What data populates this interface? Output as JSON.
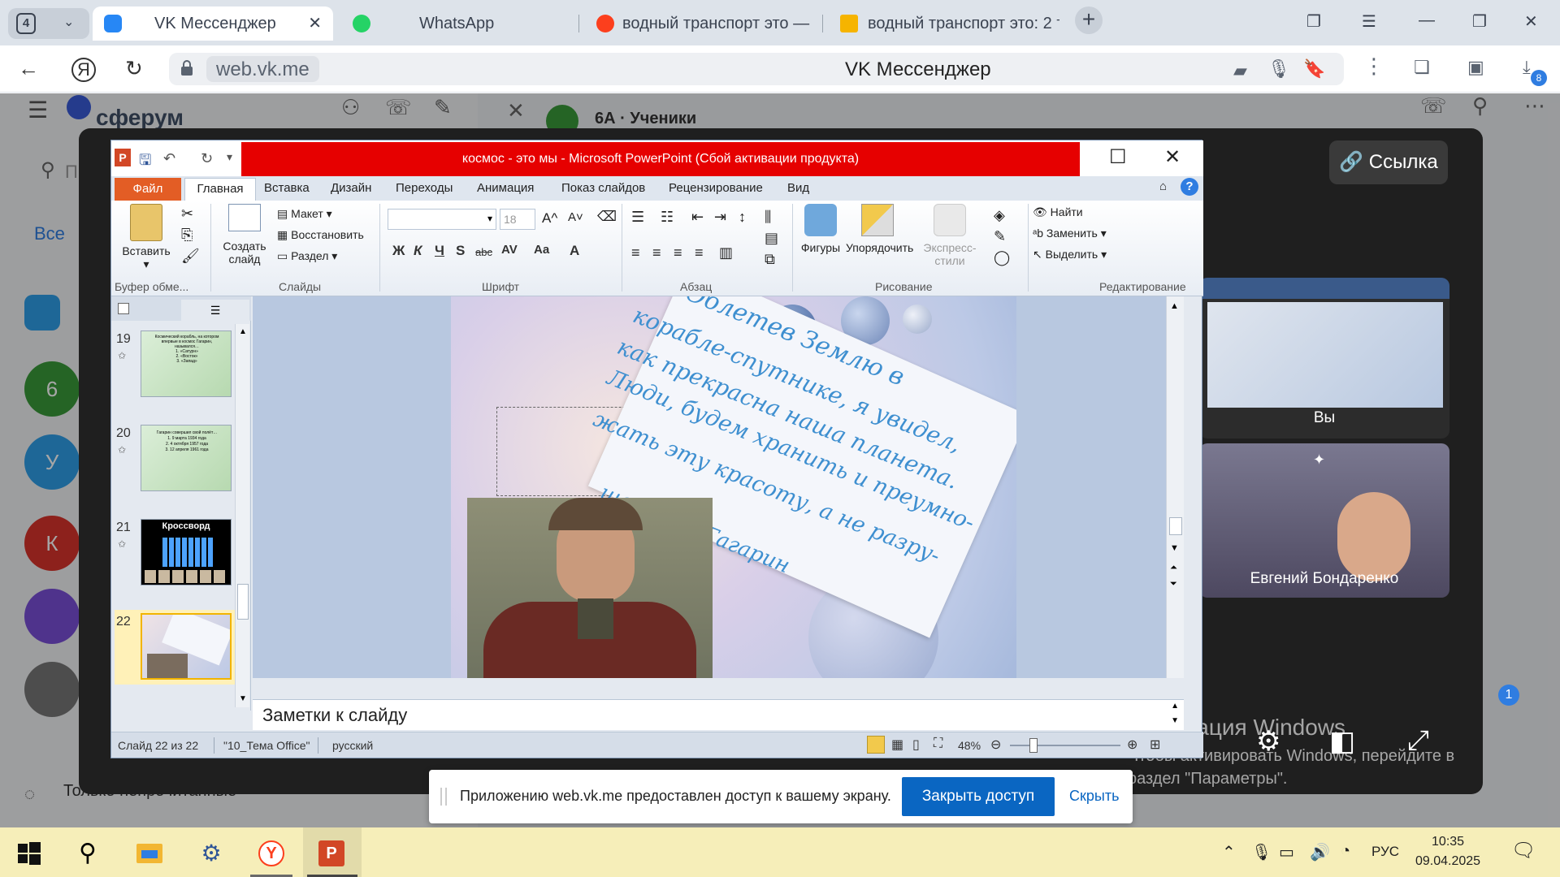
{
  "browser": {
    "tab_count": "4",
    "tabs": [
      {
        "title": "VK Мессенджер",
        "active": true
      },
      {
        "title": "WhatsApp",
        "active": false
      },
      {
        "title": "водный транспорт это — ",
        "active": false
      },
      {
        "title": "водный транспорт это: 2 т",
        "active": false
      }
    ],
    "url": "web.vk.me",
    "page_title": "VK Мессенджер",
    "downloads_badge": "8"
  },
  "vk": {
    "logo": "сферум",
    "chat_title": "6А · Ученики",
    "search_placeholder": "П",
    "filter_all": "Все",
    "avatars": [
      "6",
      "У",
      "К"
    ],
    "unread_only": "Только непрочитанные",
    "link_button": "Ссылка",
    "tiles": {
      "self_label": "Вы",
      "participant_name": "Евгений Бондаренко"
    },
    "badge_count": "1"
  },
  "windows_activation": {
    "line1": "Активация Windows",
    "line2": "Чтобы активировать Windows, перейдите в",
    "line3": "раздел \"Параметры\"."
  },
  "powerpoint": {
    "title": "космос - это мы - Microsoft PowerPoint (Сбой активации продукта)",
    "tabs": {
      "file": "Файл",
      "home": "Главная",
      "insert": "Вставка",
      "design": "Дизайн",
      "transitions": "Переходы",
      "animation": "Анимация",
      "slideshow": "Показ слайдов",
      "review": "Рецензирование",
      "view": "Вид"
    },
    "ribbon": {
      "paste": "Вставить",
      "clipboard_group": "Буфер обме...",
      "new_slide_1": "Создать",
      "new_slide_2": "слайд",
      "layout": "Макет",
      "reset": "Восстановить",
      "section": "Раздел",
      "slides_group": "Слайды",
      "font_size": "18",
      "font_group": "Шрифт",
      "paragraph_group": "Абзац",
      "shapes": "Фигуры",
      "arrange": "Упорядочить",
      "quick_styles": "Экспресс-стили",
      "drawing_group": "Рисование",
      "find": "Найти",
      "replace": "Заменить",
      "select": "Выделить",
      "editing_group": "Редактирование"
    },
    "slides": [
      {
        "num": "19",
        "lines": [
          "Космический корабль, на котором",
          "впервые в космос Гагарин,",
          "назывался…",
          "1. «Сатурн»",
          "2. «Восток»",
          "3. «Запад»"
        ]
      },
      {
        "num": "20",
        "lines": [
          "Гагарин совершил свой полёт…",
          "1. 9 марта 1934 года",
          "2. 4 октября 1957 года",
          "3. 12 апреля 1961 года"
        ]
      },
      {
        "num": "21",
        "lines": [
          "Кроссворд"
        ]
      },
      {
        "num": "22",
        "lines": []
      }
    ],
    "slide_text": [
      "Облетев Землю в",
      "корабле-спутнике, я увидел,",
      "как прекрасна наша планета.",
      "Люди, будем хранить и преумно-",
      "жать эту красоту, а не разру-",
      "шать её! Гагарин"
    ],
    "notes_placeholder": "Заметки к слайду",
    "status": {
      "slide_of": "Слайд 22 из 22",
      "theme": "\"10_Тема Office\"",
      "language": "русский",
      "zoom": "48%",
      "zoom_fraction": 0.48
    }
  },
  "share_notice": {
    "text": "Приложению web.vk.me предоставлен доступ к вашему экрану.",
    "stop_button": "Закрыть доступ",
    "hide_link": "Скрыть"
  },
  "taskbar": {
    "lang": "РУС",
    "time": "10:35",
    "date": "09.04.2025"
  },
  "colors": {
    "ppt_title_bg": "#e60000",
    "ppt_file_tab": "#e35d25",
    "share_button": "#0a66c2",
    "taskbar_bg": "#f6eeb9",
    "handwriting": "#3e8fd0"
  }
}
